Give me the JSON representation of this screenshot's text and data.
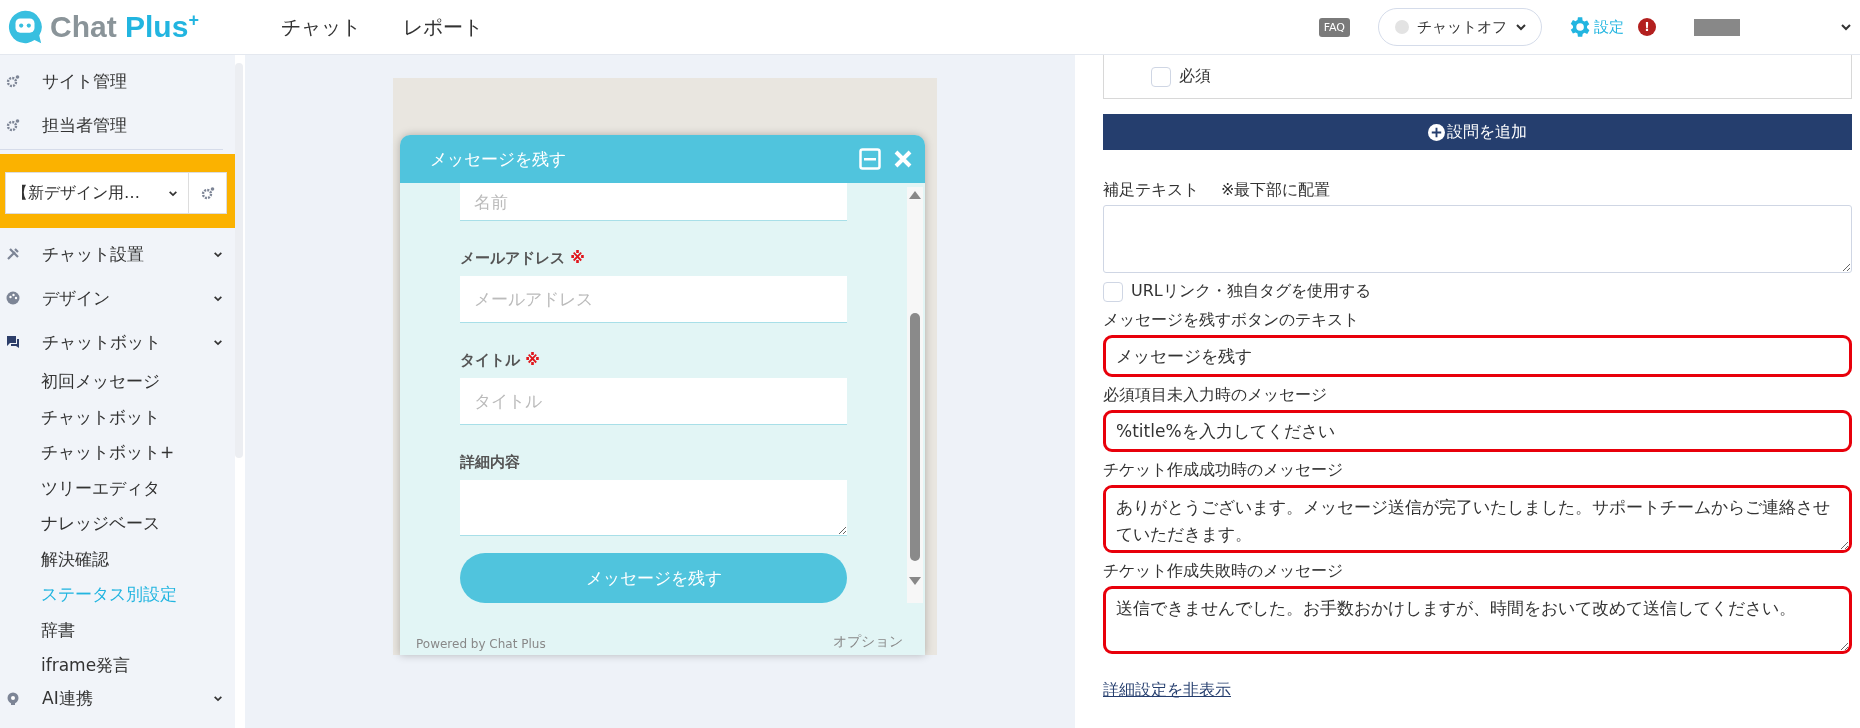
{
  "header": {
    "logo": {
      "word_1": "Chat",
      "word_2": "Plus",
      "mark": "+"
    },
    "nav": [
      {
        "label": "チャット",
        "selected": false
      },
      {
        "label": "レポート",
        "selected": false
      }
    ],
    "faq": "FAQ",
    "chat_status": {
      "label": "チャットオフ",
      "on": false
    },
    "settings": "設定",
    "alert": "!"
  },
  "sidebar": {
    "top_items": [
      {
        "label": "サイト管理"
      },
      {
        "label": "担当者管理"
      }
    ],
    "site_select": "【新デザイン用…",
    "menus": [
      {
        "label": "チャット設置"
      },
      {
        "label": "デザイン"
      },
      {
        "label": "チャットボット",
        "children": [
          {
            "label": "初回メッセージ",
            "selected": false
          },
          {
            "label": "チャットボット",
            "selected": false
          },
          {
            "label": "チャットボット+",
            "selected": false
          },
          {
            "label": "ツリーエディタ",
            "selected": false
          },
          {
            "label": "ナレッジベース",
            "selected": false
          },
          {
            "label": "解決確認",
            "selected": false
          },
          {
            "label": "ステータス別設定",
            "selected": true
          },
          {
            "label": "辞書",
            "selected": false
          },
          {
            "label": "iframe発言",
            "selected": false
          }
        ]
      },
      {
        "label": "AI連携"
      }
    ]
  },
  "preview": {
    "title": "メッセージを残す",
    "fields": [
      {
        "kind": "input",
        "placeholder": "名前"
      },
      {
        "kind": "input",
        "label": "メールアドレス",
        "required_mark": "※",
        "placeholder": "メールアドレス"
      },
      {
        "kind": "input",
        "label": "タイトル",
        "required_mark": "※",
        "placeholder": "タイトル"
      },
      {
        "kind": "textarea",
        "label": "詳細内容"
      }
    ],
    "button": "メッセージを残す",
    "powered_by": "Powered by Chat Plus",
    "options": "オプション"
  },
  "form": {
    "required_checkbox": {
      "label": "必須",
      "checked": false
    },
    "add_button": "設問を追加",
    "supplement": {
      "label": "補足テキスト",
      "note": "※最下部に配置"
    },
    "url_checkbox": {
      "label": "URLリンク・独自タグを使用する",
      "checked": false
    },
    "fields": [
      {
        "kind": "input",
        "label": "メッセージを残すボタンのテキスト",
        "value": "メッセージを残す",
        "highlighted": true
      },
      {
        "kind": "input",
        "label": "必須項目未入力時のメッセージ",
        "value": "%title%を入力してください",
        "highlighted": true
      },
      {
        "kind": "textarea",
        "label": "チケット作成成功時のメッセージ",
        "value": "ありがとうございます。メッセージ送信が完了いたしました。サポートチームからご連絡させていただきます。",
        "highlighted": true
      },
      {
        "kind": "textarea",
        "label": "チケット作成失敗時のメッセージ",
        "value": "送信できませんでした。お手数おかけしますが、時間をおいて改めて送信してください。",
        "highlighted": true
      }
    ],
    "toggle_link": "詳細設定を非表示"
  }
}
